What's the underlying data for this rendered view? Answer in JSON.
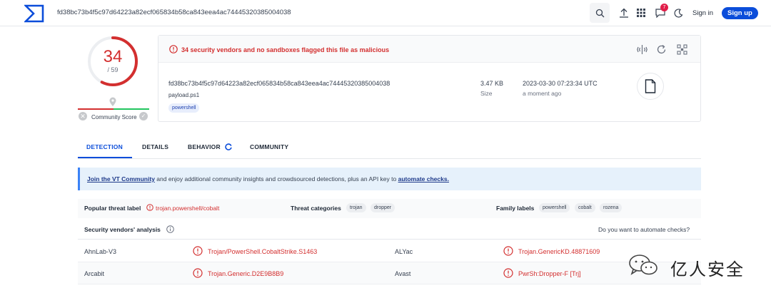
{
  "header": {
    "search_value": "fd38bc73b4f5c97d64223a82ecf065834b58ca843eea4ac74445320385004038",
    "notification_count": "7",
    "signin_label": "Sign in",
    "signup_label": "Sign up"
  },
  "score": {
    "detections": "34",
    "total": "/ 59",
    "community_label": "Community Score",
    "ratio": 0.576
  },
  "summary": {
    "alert": "34 security vendors and no sandboxes flagged this file as malicious",
    "hash": "fd38bc73b4f5c97d64223a82ecf065834b58ca843eea4ac74445320385004038",
    "filename": "payload.ps1",
    "tag": "powershell",
    "size_value": "3.47 KB",
    "size_label": "Size",
    "date_value": "2023-03-30 07:23:34 UTC",
    "date_relative": "a moment ago"
  },
  "tabs": [
    {
      "label": "DETECTION"
    },
    {
      "label": "DETAILS"
    },
    {
      "label": "BEHAVIOR"
    },
    {
      "label": "COMMUNITY"
    }
  ],
  "banner": {
    "link1": "Join the VT Community",
    "middle": " and enjoy additional community insights and crowdsourced detections, plus an API key to ",
    "link2": "automate checks."
  },
  "labels": {
    "popular_title": "Popular threat label",
    "popular_value": "trojan.powershell/cobalt",
    "categories_title": "Threat categories",
    "categories": [
      "trojan",
      "dropper"
    ],
    "family_title": "Family labels",
    "families": [
      "powershell",
      "cobalt",
      "rozena"
    ]
  },
  "analysis": {
    "title": "Security vendors' analysis",
    "automate_prompt": "Do you want to automate checks?",
    "rows": [
      {
        "v1": "AhnLab-V3",
        "d1": "Trojan/PowerShell.CobaltStrike.S1463",
        "v2": "ALYac",
        "d2": "Trojan.GenericKD.48871609"
      },
      {
        "v1": "Arcabit",
        "d1": "Trojan.Generic.D2E9B8B9",
        "v2": "Avast",
        "d2": "PwrSh:Dropper-F [Trj]"
      }
    ]
  },
  "watermark": {
    "text": "亿人安全"
  },
  "colors": {
    "accent": "#0b4dda",
    "malicious": "#d32f2f"
  }
}
